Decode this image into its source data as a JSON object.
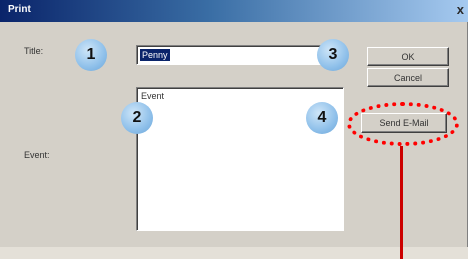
{
  "window": {
    "title": "Print",
    "close_glyph": "x"
  },
  "fields": {
    "title_label": "Title:",
    "title_value": "Penny",
    "event_label": "Event:",
    "event_value": "Event"
  },
  "buttons": {
    "ok": "OK",
    "cancel": "Cancel",
    "send_email": "Send E-Mail"
  },
  "annotations": {
    "badge_1": "1",
    "badge_2": "2",
    "badge_3": "3",
    "badge_4": "4",
    "highlight_color": "#ff0000"
  }
}
